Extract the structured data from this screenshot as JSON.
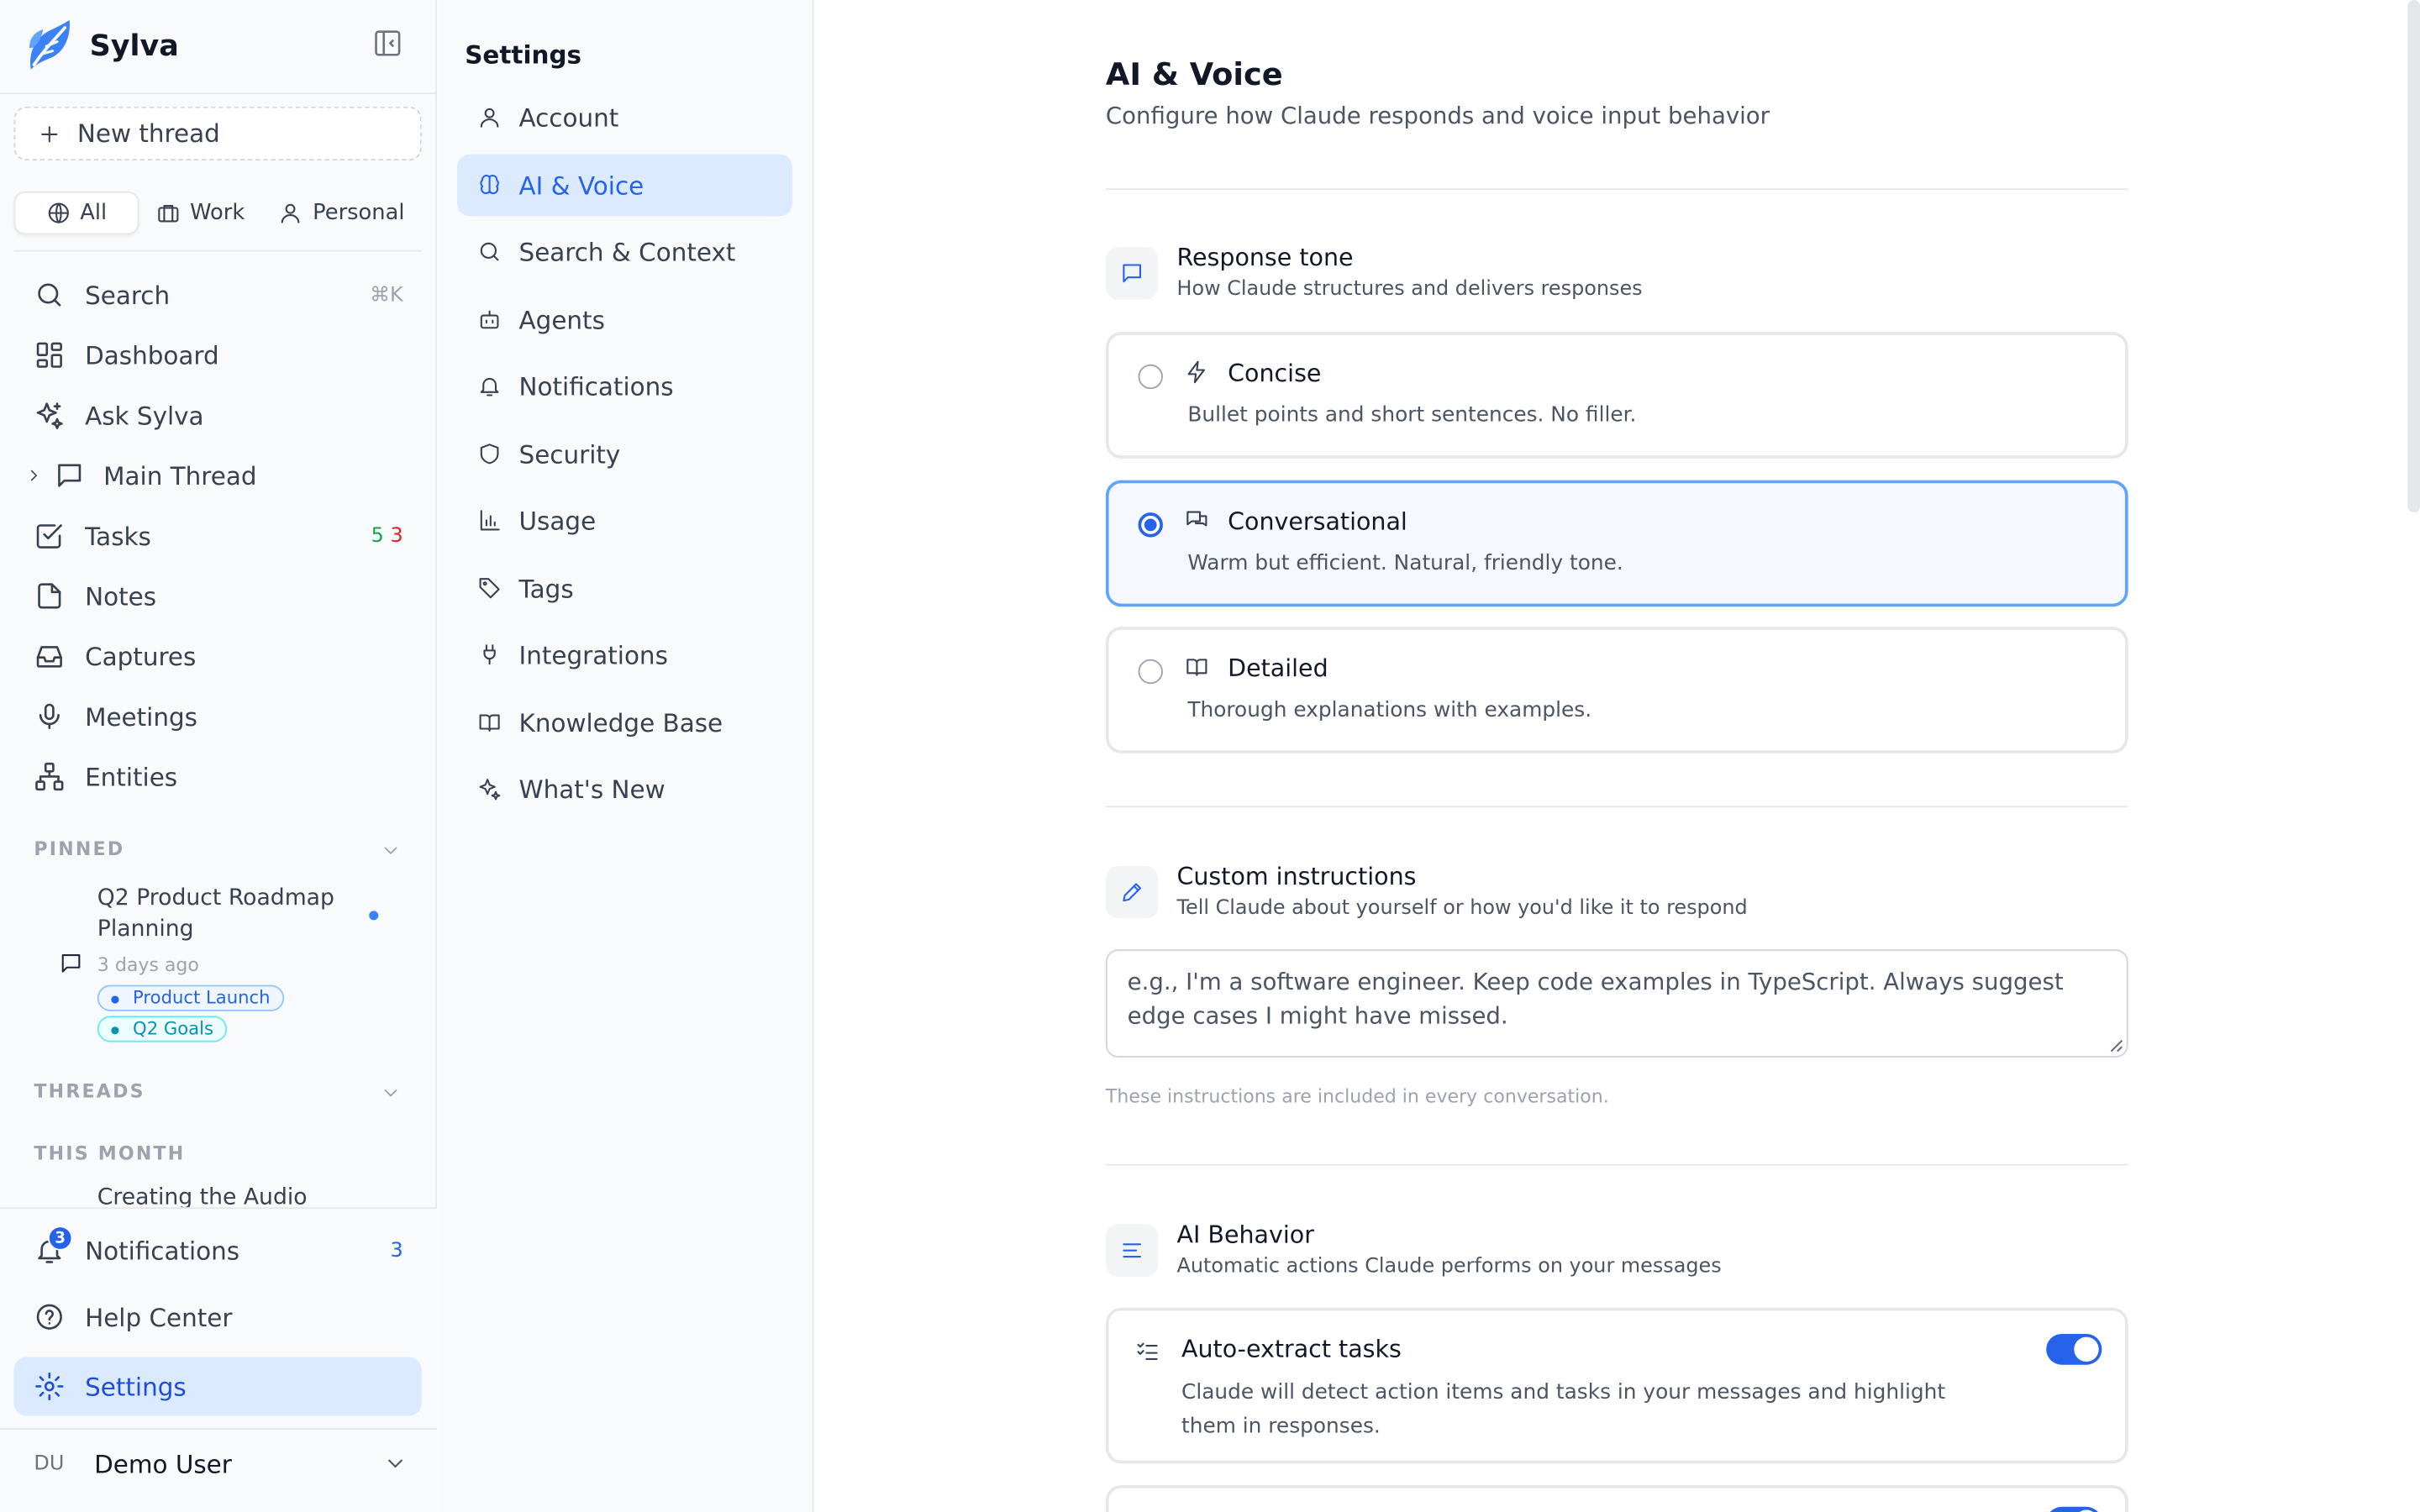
{
  "brand": {
    "name": "Sylva",
    "accent": "#2563eb"
  },
  "sidebar": {
    "new_thread": "New thread",
    "filters": [
      {
        "label": "All",
        "icon": "globe-icon",
        "active": true
      },
      {
        "label": "Work",
        "icon": "briefcase-icon",
        "active": false
      },
      {
        "label": "Personal",
        "icon": "user-icon",
        "active": false
      }
    ],
    "nav": [
      {
        "label": "Search",
        "icon": "search-icon",
        "shortcut": "⌘K"
      },
      {
        "label": "Dashboard",
        "icon": "dashboard-icon"
      },
      {
        "label": "Ask Sylva",
        "icon": "sparkles-icon"
      },
      {
        "label": "Main Thread",
        "icon": "message-icon"
      },
      {
        "label": "Tasks",
        "icon": "checkbox-icon",
        "count_green": "5",
        "count_red": "3"
      },
      {
        "label": "Notes",
        "icon": "file-icon"
      },
      {
        "label": "Captures",
        "icon": "inbox-icon"
      },
      {
        "label": "Meetings",
        "icon": "microphone-icon"
      },
      {
        "label": "Entities",
        "icon": "network-icon"
      }
    ],
    "pinned_label": "PINNED",
    "pinned": {
      "title": "Q2 Product Roadmap Planning",
      "time": "3 days ago",
      "tags": [
        "Product Launch",
        "Q2 Goals"
      ]
    },
    "threads_label": "THREADS",
    "this_month_label": "THIS MONTH",
    "cut_item": "Creating the Audio",
    "bottom": [
      {
        "label": "Notifications",
        "icon": "bell-icon",
        "count": "3",
        "badge": "3"
      },
      {
        "label": "Help Center",
        "icon": "help-icon"
      },
      {
        "label": "Settings",
        "icon": "gear-icon",
        "active": true
      }
    ],
    "user": {
      "initials": "DU",
      "name": "Demo User"
    }
  },
  "settings_nav": {
    "title": "Settings",
    "items": [
      {
        "label": "Account",
        "icon": "user-icon"
      },
      {
        "label": "AI & Voice",
        "icon": "brain-icon",
        "active": true
      },
      {
        "label": "Search & Context",
        "icon": "search-icon"
      },
      {
        "label": "Agents",
        "icon": "bot-icon"
      },
      {
        "label": "Notifications",
        "icon": "bell-icon"
      },
      {
        "label": "Security",
        "icon": "shield-icon"
      },
      {
        "label": "Usage",
        "icon": "bar-chart-icon"
      },
      {
        "label": "Tags",
        "icon": "tag-icon"
      },
      {
        "label": "Integrations",
        "icon": "plug-icon"
      },
      {
        "label": "Knowledge Base",
        "icon": "book-icon"
      },
      {
        "label": "What's New",
        "icon": "sparkles-icon"
      }
    ]
  },
  "main": {
    "title": "AI & Voice",
    "subtitle": "Configure how Claude responds and voice input behavior",
    "tone": {
      "title": "Response tone",
      "desc": "How Claude structures and delivers responses",
      "options": [
        {
          "label": "Concise",
          "desc": "Bullet points and short sentences. No filler.",
          "selected": false
        },
        {
          "label": "Conversational",
          "desc": "Warm but efficient. Natural, friendly tone.",
          "selected": true
        },
        {
          "label": "Detailed",
          "desc": "Thorough explanations with examples.",
          "selected": false
        }
      ]
    },
    "custom": {
      "title": "Custom instructions",
      "desc": "Tell Claude about yourself or how you'd like it to respond",
      "placeholder": "e.g., I'm a software engineer. Keep code examples in TypeScript. Always suggest edge cases I might have missed.",
      "hint": "These instructions are included in every conversation."
    },
    "behavior": {
      "title": "AI Behavior",
      "desc": "Automatic actions Claude performs on your messages",
      "auto_extract": {
        "title": "Auto-extract tasks",
        "desc": "Claude will detect action items and tasks in your messages and highlight them in responses.",
        "enabled": true
      }
    }
  }
}
